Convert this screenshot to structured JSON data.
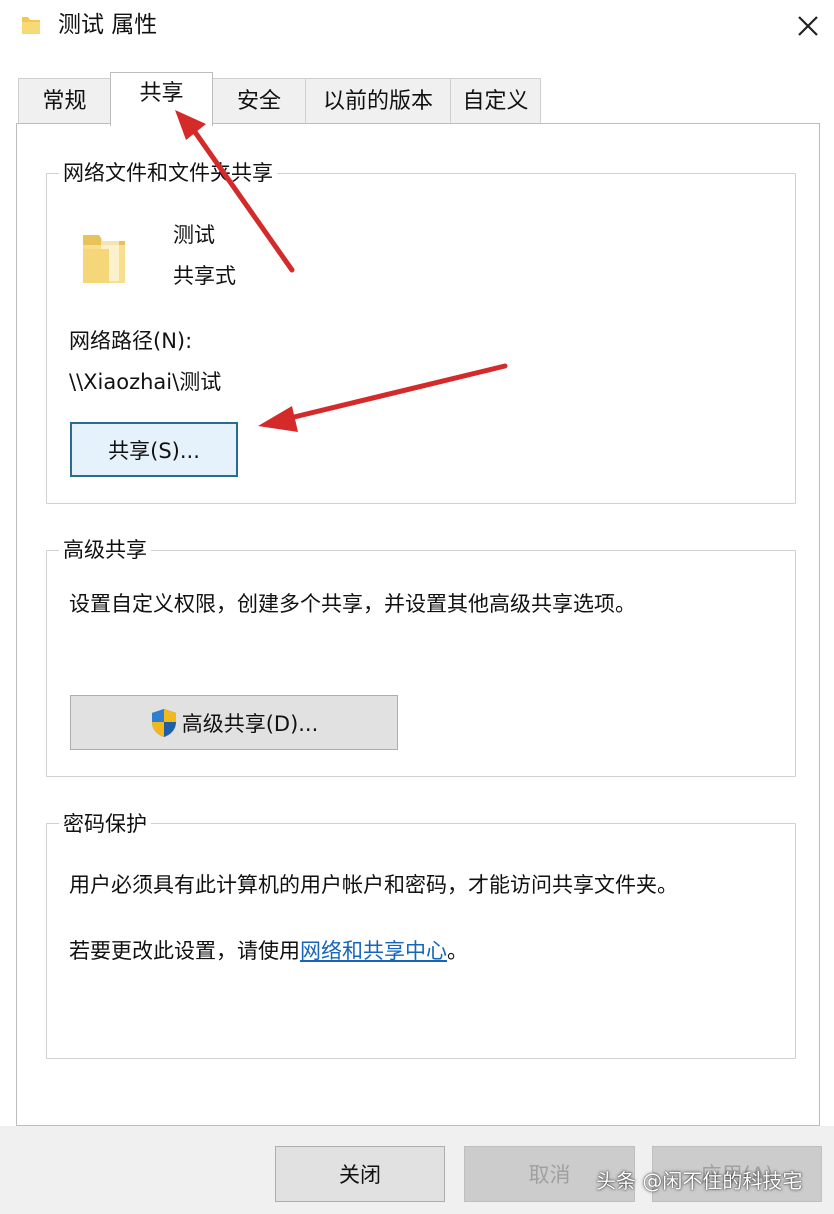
{
  "window": {
    "title": "测试 属性",
    "title_icon": "folder-icon",
    "close_icon": "close-icon"
  },
  "tabs": [
    {
      "label": "常规",
      "active": false
    },
    {
      "label": "共享",
      "active": true
    },
    {
      "label": "安全",
      "active": false
    },
    {
      "label": "以前的版本",
      "active": false
    },
    {
      "label": "自定义",
      "active": false
    }
  ],
  "network_sharing": {
    "group_title": "网络文件和文件夹共享",
    "folder_icon": "folder-icon",
    "folder_name": "测试",
    "share_status": "共享式",
    "network_path_label": "网络路径(N):",
    "network_path_value": "\\\\Xiaozhai\\测试",
    "share_button_label": "共享(S)..."
  },
  "advanced_sharing": {
    "group_title": "高级共享",
    "description": "设置自定义权限，创建多个共享，并设置其他高级共享选项。",
    "button_icon": "uac-shield-icon",
    "button_label": "高级共享(D)..."
  },
  "password_protection": {
    "group_title": "密码保护",
    "description": "用户必须具有此计算机的用户帐户和密码，才能访问共享文件夹。",
    "change_prefix": "若要更改此设置，请使用",
    "link_label": "网络和共享中心",
    "change_suffix": "。"
  },
  "footer": {
    "close_label": "关闭",
    "cancel_label": "取消",
    "apply_label": "应用(A)"
  },
  "annotations": {
    "arrow_color": "#d42a2a"
  },
  "watermark": {
    "text": "头条 @闲不住的科技宅"
  },
  "colors": {
    "focus_border": "#2a6b8f",
    "link": "#1566b8",
    "folder": "#f5d77a"
  }
}
